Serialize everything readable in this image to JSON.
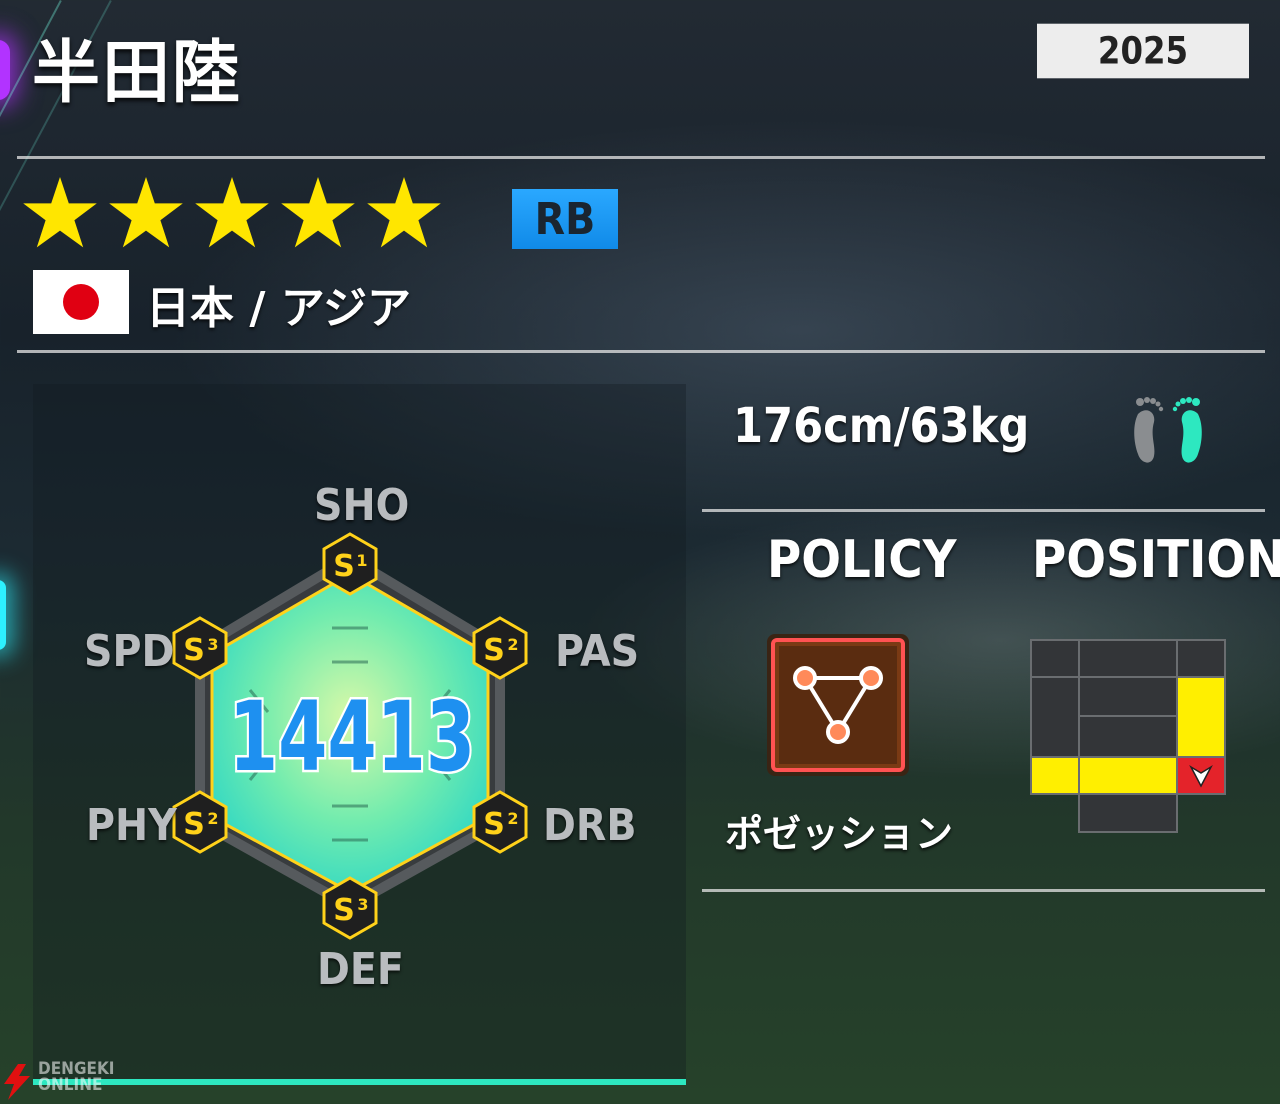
{
  "player": {
    "name": "半田陸",
    "year": "2025",
    "rarity_stars": 5,
    "position": "RB",
    "nationality": "日本 / アジア",
    "flag": "japan-flag",
    "body": "176cm/63kg",
    "preferred_foot": "right"
  },
  "radar": {
    "total": "14413",
    "stats": [
      {
        "key": "sho",
        "label": "SHO",
        "grade": "S",
        "tier": "1"
      },
      {
        "key": "pas",
        "label": "PAS",
        "grade": "S",
        "tier": "2"
      },
      {
        "key": "drb",
        "label": "DRB",
        "grade": "S",
        "tier": "2"
      },
      {
        "key": "def",
        "label": "DEF",
        "grade": "S",
        "tier": "3"
      },
      {
        "key": "phy",
        "label": "PHY",
        "grade": "S",
        "tier": "2"
      },
      {
        "key": "spd",
        "label": "SPD",
        "grade": "S",
        "tier": "3"
      }
    ]
  },
  "info": {
    "policy_header": "POLICY",
    "position_header": "POSITION",
    "policy_name": "ポゼッション",
    "policy_icon": "possession-triangle-icon"
  },
  "position_map": {
    "highlighted": [
      "right-midfield",
      "right-back",
      "right-center-back"
    ],
    "current": "right-back"
  },
  "watermark": {
    "line1": "DENGEKI",
    "line2": "ONLINE"
  },
  "colors": {
    "accent": "#2de8c0",
    "star": "#ffe600",
    "position_badge": "#1e9cf5",
    "grid_on": "#ffef00",
    "grid_current": "#e4232a"
  }
}
